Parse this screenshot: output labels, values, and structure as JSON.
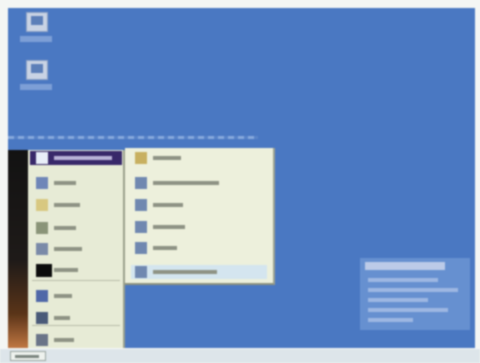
{
  "colors": {
    "desktop": "#4a78c2",
    "menu_bg": "#e7ebd6",
    "submenu_bg": "#edf0dc",
    "highlight": "#38286a",
    "taskbar": "#dde5ea"
  },
  "desktop": {
    "icons": [
      {
        "icon": "computer-icon"
      },
      {
        "icon": "network-icon"
      }
    ]
  },
  "start_menu": {
    "items": [
      {
        "icon": "update-icon",
        "highlighted": true
      },
      {
        "icon": "programs-icon"
      },
      {
        "icon": "documents-icon"
      },
      {
        "icon": "settings-icon"
      },
      {
        "icon": "find-icon"
      },
      {
        "icon": "black-app-icon"
      },
      {
        "icon": "help-icon"
      },
      {
        "icon": "run-icon"
      },
      {
        "icon": "shutdown-icon"
      }
    ]
  },
  "submenu": {
    "items": [
      {
        "icon": "folder-icon"
      },
      {
        "icon": "program-icon"
      },
      {
        "icon": "program-icon"
      },
      {
        "icon": "program-icon"
      },
      {
        "icon": "program-icon"
      },
      {
        "icon": "program-icon",
        "highlighted": true
      }
    ]
  },
  "taskbar": {
    "start_icon": "start-icon"
  }
}
